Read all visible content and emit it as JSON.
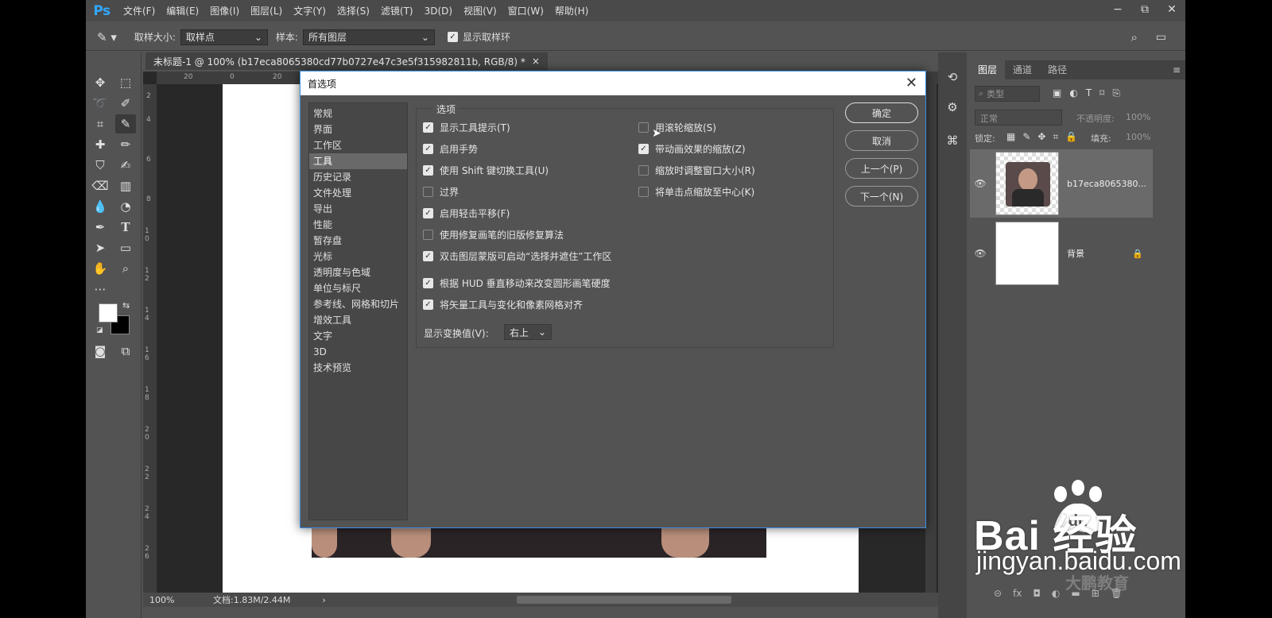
{
  "app": {
    "logo": "Ps",
    "menu": [
      "文件(F)",
      "编辑(E)",
      "图像(I)",
      "图层(L)",
      "文字(Y)",
      "选择(S)",
      "滤镜(T)",
      "3D(D)",
      "视图(V)",
      "窗口(W)",
      "帮助(H)"
    ],
    "window_controls": [
      "−",
      "⧉",
      "✕"
    ]
  },
  "options_bar": {
    "sample_size_label": "取样大小:",
    "sample_size_value": "取样点",
    "sample_label": "样本:",
    "sample_value": "所有图层",
    "show_ring_label": "显示取样环",
    "show_ring_checked": true
  },
  "document": {
    "tab_title": "未标题-1 @ 100% (b17eca8065380cd77b0727e47c3e5f315982811b, RGB/8) *",
    "tab_close": "×",
    "zoom": "100%",
    "doc_info": "文档:1.83M/2.44M",
    "ruler_top": [
      "20",
      "0",
      "20"
    ],
    "ruler_left": [
      "2",
      "4",
      "6",
      "8",
      "1 0",
      "1 2",
      "1 4",
      "1 6",
      "1 8",
      "2 0",
      "2 2",
      "2 4",
      "2 6"
    ]
  },
  "layers_panel": {
    "tabs": [
      "图层",
      "通道",
      "路径"
    ],
    "kind_label": "类型",
    "blend_mode": "正常",
    "opacity_label": "不透明度:",
    "opacity_value": "100%",
    "lock_label": "锁定:",
    "fill_label": "填充:",
    "fill_value": "100%",
    "layers": [
      {
        "name": "b17eca8065380...",
        "visible": true,
        "selected": true
      },
      {
        "name": "背景",
        "visible": true,
        "selected": false,
        "locked": true
      }
    ]
  },
  "dialog": {
    "title": "首选项",
    "categories": [
      "常规",
      "界面",
      "工作区",
      "工具",
      "历史记录",
      "文件处理",
      "导出",
      "性能",
      "暂存盘",
      "光标",
      "透明度与色域",
      "单位与标尺",
      "参考线、网格和切片",
      "增效工具",
      "文字",
      "3D",
      "技术预览"
    ],
    "selected_category": "工具",
    "group_label": "选项",
    "left_options": [
      {
        "label": "显示工具提示(T)",
        "checked": true
      },
      {
        "label": "启用手势",
        "checked": true
      },
      {
        "label": "使用 Shift 键切换工具(U)",
        "checked": true
      },
      {
        "label": "过界",
        "checked": false
      },
      {
        "label": "启用轻击平移(F)",
        "checked": true
      },
      {
        "label": "使用修复画笔的旧版修复算法",
        "checked": false
      },
      {
        "label": "双击图层蒙版可启动“选择并遮住”工作区",
        "checked": true
      },
      {
        "label": "根据 HUD 垂直移动来改变圆形画笔硬度",
        "checked": true
      },
      {
        "label": "将矢量工具与变化和像素网格对齐",
        "checked": true
      }
    ],
    "right_options": [
      {
        "label": "用滚轮缩放(S)",
        "checked": false
      },
      {
        "label": "带动画效果的缩放(Z)",
        "checked": true
      },
      {
        "label": "缩放时调整窗口大小(R)",
        "checked": false
      },
      {
        "label": "将单击点缩放至中心(K)",
        "checked": false
      }
    ],
    "hud_label": "显示变换值(V):",
    "hud_value": "右上",
    "buttons": {
      "ok": "确定",
      "cancel": "取消",
      "prev": "上一个(P)",
      "next": "下一个(N)"
    }
  },
  "watermark": {
    "logo_text": "Bai  经验",
    "du": "du",
    "url": "jingyan.baidu.com",
    "faint_text": "大鹏教育"
  },
  "colors": {
    "ps_blue": "#31a8ff",
    "dialog_border": "#3a8ee6",
    "panel_bg": "#535353"
  }
}
